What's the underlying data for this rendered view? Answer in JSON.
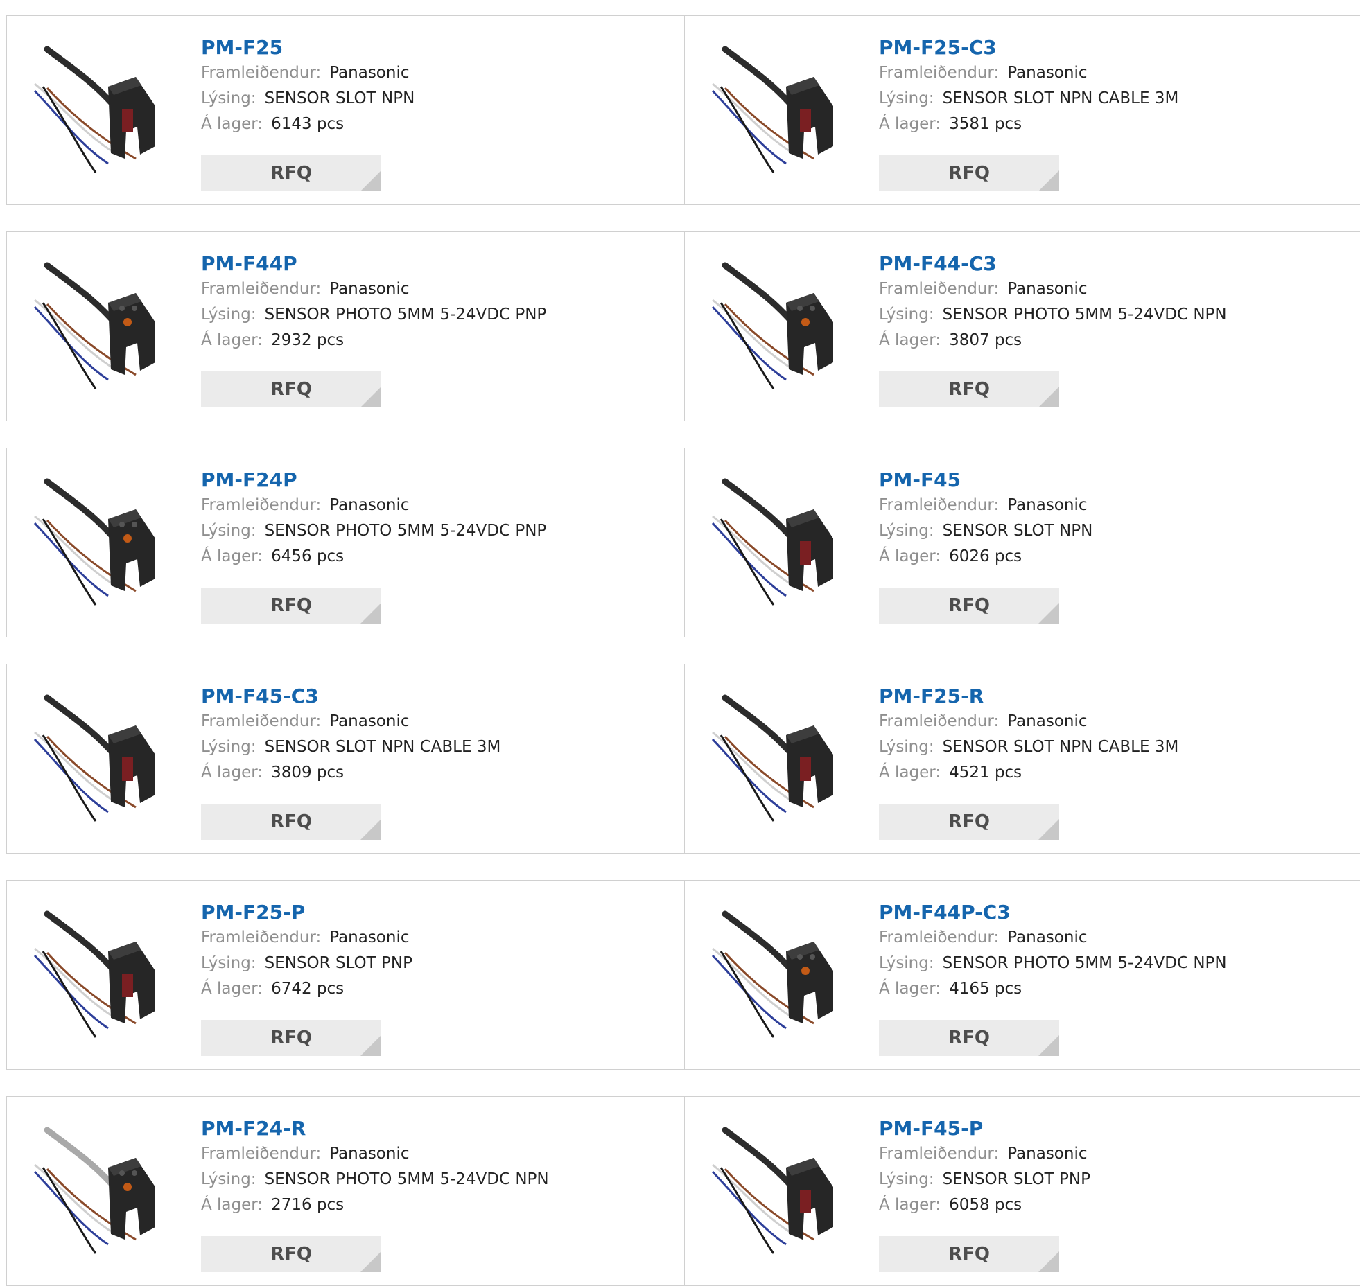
{
  "labels": {
    "manufacturer": "Framleiðendur:",
    "description": "Lýsing:",
    "stock": "Á lager:",
    "rfq": "RFQ"
  },
  "products": [
    {
      "name": "PM-F25",
      "manufacturer": "Panasonic",
      "description": "SENSOR SLOT NPN",
      "stock": "6143 pcs",
      "image": "slot-sensor-red-icon"
    },
    {
      "name": "PM-F25-C3",
      "manufacturer": "Panasonic",
      "description": "SENSOR SLOT NPN CABLE 3M",
      "stock": "3581 pcs",
      "image": "slot-sensor-red-icon"
    },
    {
      "name": "PM-F44P",
      "manufacturer": "Panasonic",
      "description": "SENSOR PHOTO 5MM 5-24VDC PNP",
      "stock": "2932 pcs",
      "image": "slot-sensor-black-icon"
    },
    {
      "name": "PM-F44-C3",
      "manufacturer": "Panasonic",
      "description": "SENSOR PHOTO 5MM 5-24VDC NPN",
      "stock": "3807 pcs",
      "image": "slot-sensor-black-icon"
    },
    {
      "name": "PM-F24P",
      "manufacturer": "Panasonic",
      "description": "SENSOR PHOTO 5MM 5-24VDC PNP",
      "stock": "6456 pcs",
      "image": "slot-sensor-black-icon"
    },
    {
      "name": "PM-F45",
      "manufacturer": "Panasonic",
      "description": "SENSOR SLOT NPN",
      "stock": "6026 pcs",
      "image": "slot-sensor-red-icon"
    },
    {
      "name": "PM-F45-C3",
      "manufacturer": "Panasonic",
      "description": "SENSOR SLOT NPN CABLE 3M",
      "stock": "3809 pcs",
      "image": "slot-sensor-red-icon"
    },
    {
      "name": "PM-F25-R",
      "manufacturer": "Panasonic",
      "description": "SENSOR SLOT NPN CABLE 3M",
      "stock": "4521 pcs",
      "image": "slot-sensor-red-icon"
    },
    {
      "name": "PM-F25-P",
      "manufacturer": "Panasonic",
      "description": "SENSOR SLOT PNP",
      "stock": "6742 pcs",
      "image": "slot-sensor-red-icon"
    },
    {
      "name": "PM-F44P-C3",
      "manufacturer": "Panasonic",
      "description": "SENSOR PHOTO 5MM 5-24VDC NPN",
      "stock": "4165 pcs",
      "image": "slot-sensor-black-icon"
    },
    {
      "name": "PM-F24-R",
      "manufacturer": "Panasonic",
      "description": "SENSOR PHOTO 5MM 5-24VDC NPN",
      "stock": "2716 pcs",
      "image": "slot-sensor-grey-cable-icon"
    },
    {
      "name": "PM-F45-P",
      "manufacturer": "Panasonic",
      "description": "SENSOR SLOT PNP",
      "stock": "6058 pcs",
      "image": "slot-sensor-red-icon"
    }
  ],
  "colors": {
    "product_link": "#1565ad",
    "label": "#8f8f8f",
    "value": "#222222",
    "border": "#d0d0d0",
    "rfq_bg": "#ebebeb",
    "rfq_text": "#4d4d4d"
  }
}
